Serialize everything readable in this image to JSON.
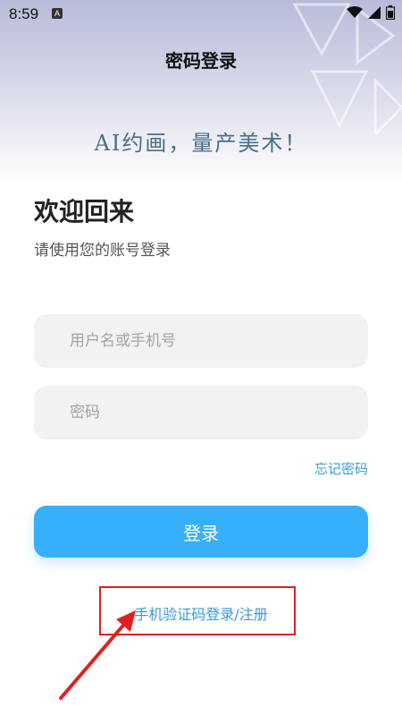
{
  "status_bar": {
    "time": "8:59",
    "app_badge": "A",
    "icons": [
      "wifi-icon",
      "cellular-signal-icon",
      "battery-icon"
    ]
  },
  "header": {
    "title": "密码登录",
    "slogan": "AI约画，量产美术！"
  },
  "main": {
    "welcome": "欢迎回来",
    "subtitle": "请使用您的账号登录",
    "username_placeholder": "用户名或手机号",
    "password_placeholder": "密码",
    "forgot_label": "忘记密码",
    "login_label": "登录",
    "sms_link": "手机验证码登录/注册"
  },
  "colors": {
    "accent": "#37b0fb",
    "link": "#3a9ad9",
    "annotation": "#e02020"
  }
}
